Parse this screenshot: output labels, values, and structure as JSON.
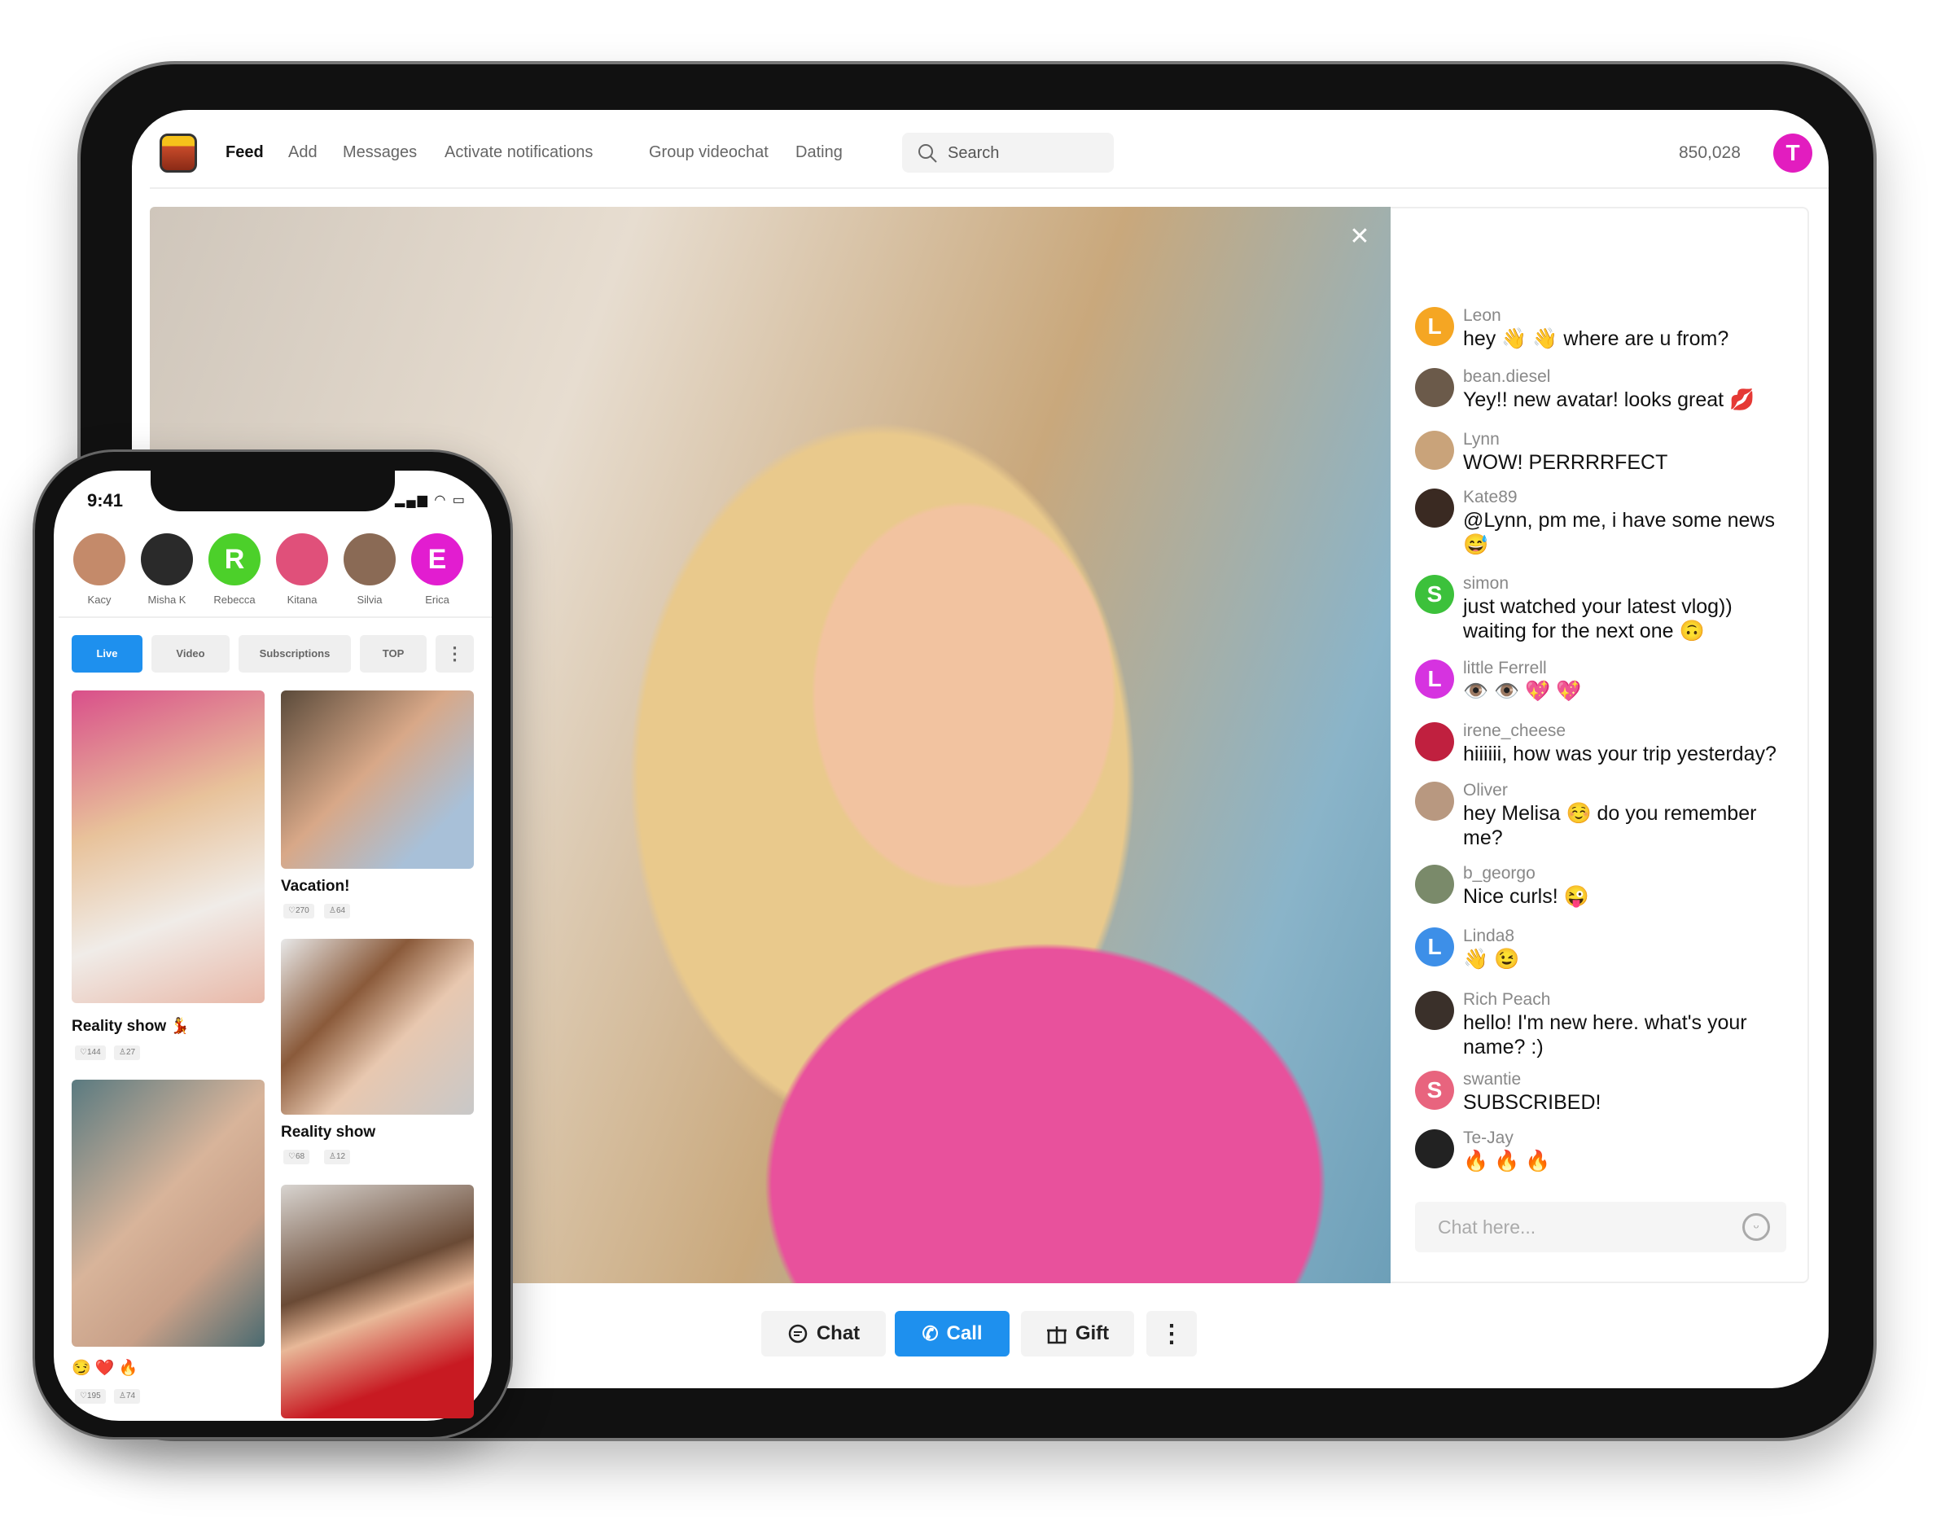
{
  "header": {
    "nav": [
      "Feed",
      "Add",
      "Messages",
      "Activate notifications",
      "Group videochat",
      "Dating"
    ],
    "search_placeholder": "Search",
    "balance": "850,028",
    "user_initial": "T"
  },
  "colors": {
    "accent": "#1e90ee",
    "user_avatar": "#e21dbf"
  },
  "video": {
    "close_icon": "close-icon"
  },
  "chat": {
    "messages": [
      {
        "name": "Leon",
        "text": "hey 👋 👋  where are u from?",
        "initial": "L",
        "color": "#f5a623"
      },
      {
        "name": "bean.diesel",
        "text": "Yey!! new avatar! looks great 💋",
        "color": "#6b5a4a"
      },
      {
        "name": "Lynn",
        "text": "WOW! PERRRRFECT",
        "color": "#c9a37a"
      },
      {
        "name": "Kate89",
        "text": "@Lynn, pm me, i have some news 😅",
        "color": "#3a2a22"
      },
      {
        "name": "simon",
        "text": "just watched your latest vlog)) waiting for the next one 🙃",
        "initial": "S",
        "color": "#3cc13b"
      },
      {
        "name": "little Ferrell",
        "text": "👁️ 👁️ 💖 💖",
        "initial": "L",
        "color": "#d633e0"
      },
      {
        "name": "irene_cheese",
        "text": "hiiiiii, how was your trip yesterday?",
        "color": "#c0203f"
      },
      {
        "name": "Oliver",
        "text": "hey Melisa ☺️  do you remember me?",
        "color": "#b89880"
      },
      {
        "name": "b_georgo",
        "text": "Nice curls! 😜",
        "color": "#7a8a6a"
      },
      {
        "name": "Linda8",
        "text": "👋 😉",
        "initial": "L",
        "color": "#3d8fe8"
      },
      {
        "name": "Rich Peach",
        "text": "hello! I'm new here. what's your name? :)",
        "color": "#3a302a"
      },
      {
        "name": "swantie",
        "text": "SUBSCRIBED!",
        "initial": "S",
        "color": "#e8647e"
      },
      {
        "name": "Te-Jay",
        "text": "🔥 🔥 🔥",
        "color": "#222"
      }
    ],
    "input_placeholder": "Chat here..."
  },
  "actions": {
    "chat": "Chat",
    "call": "Call",
    "gift": "Gift"
  },
  "phone": {
    "time": "9:41",
    "stories": [
      {
        "name": "Kacy",
        "color": "#c48a6a"
      },
      {
        "name": "Misha K",
        "color": "#2a2a2a"
      },
      {
        "name": "Rebecca",
        "initial": "R",
        "color": "#4cd02a"
      },
      {
        "name": "Kitana",
        "color": "#e0507a"
      },
      {
        "name": "Silvia",
        "color": "#8a6a55"
      },
      {
        "name": "Erica",
        "initial": "E",
        "color": "#e21dd0"
      }
    ],
    "tabs": [
      "Live",
      "Video",
      "Subscriptions",
      "TOP"
    ],
    "cards": [
      {
        "title": "Reality show 💃",
        "likes": "144",
        "viewers": "27"
      },
      {
        "title": "😏 ❤️ 🔥",
        "likes": "195",
        "viewers": "74"
      },
      {
        "title": "Vacation!",
        "likes": "270",
        "viewers": "64"
      },
      {
        "title": "Reality show",
        "likes": "68",
        "viewers": "12"
      }
    ]
  }
}
